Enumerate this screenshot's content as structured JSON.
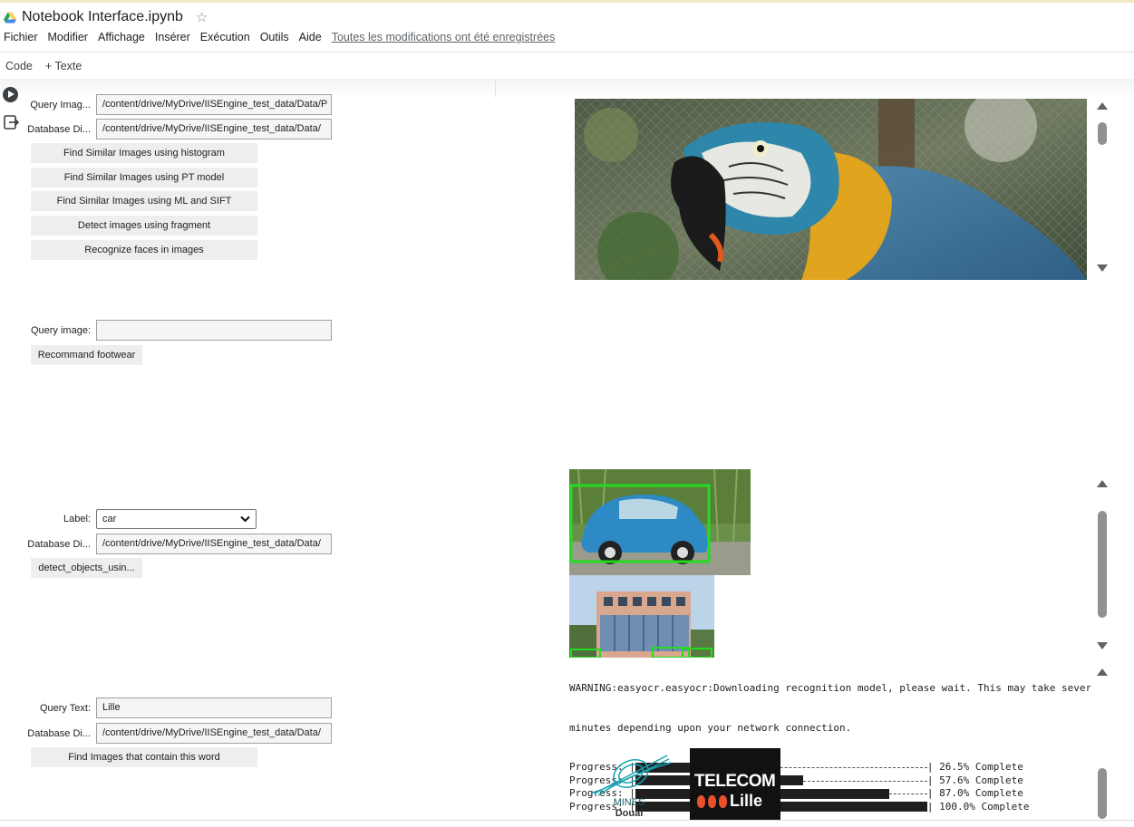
{
  "app": {
    "title": "Notebook Interface.ipynb",
    "menu": [
      "Fichier",
      "Modifier",
      "Affichage",
      "Insérer",
      "Exécution",
      "Outils",
      "Aide"
    ],
    "saved_status": "Toutes les modifications ont été enregistrées",
    "toolbar": {
      "code": "Code",
      "text": "+ Texte"
    }
  },
  "cell1": {
    "query_label": "Query Imag...",
    "query_value": "/content/drive/MyDrive/IISEngine_test_data/Data/P",
    "db_label": "Database Di...",
    "db_value": "/content/drive/MyDrive/IISEngine_test_data/Data/",
    "buttons": [
      "Find Similar Images using histogram",
      "Find Similar Images using PT model",
      "Find Similar Images using ML and SIFT",
      "Detect images using fragment",
      "Recognize faces in images"
    ]
  },
  "cell2": {
    "query_label": "Query image:",
    "query_value": "",
    "button": "Recommand footwear"
  },
  "cell3": {
    "label_label": "Label:",
    "label_value": "car",
    "db_label": "Database Di...",
    "db_value": "/content/drive/MyDrive/IISEngine_test_data/Data/",
    "button": "detect_objects_usin..."
  },
  "cell4": {
    "query_label": "Query Text:",
    "query_value": "Lille",
    "db_label": "Database Di...",
    "db_value": "/content/drive/MyDrive/IISEngine_test_data/Data/",
    "button": "Find Images that contain this word"
  },
  "console": {
    "warning_line1": "WARNING:easyocr.easyocr:Downloading recognition model, please wait. This may take several",
    "warning_line2": "minutes depending upon your network connection.",
    "progress": [
      {
        "prefix": "Progress: |",
        "fraction": 0.265,
        "suffix": "| 26.5% Complete"
      },
      {
        "prefix": "Progress: |",
        "fraction": 0.576,
        "suffix": "| 57.6% Complete"
      },
      {
        "prefix": "Progress: |",
        "fraction": 0.87,
        "suffix": "| 87.0% Complete"
      },
      {
        "prefix": "Progress: |",
        "fraction": 1.0,
        "suffix": "| 100.0% Complete"
      }
    ]
  },
  "logos": {
    "mines_line1": "MINES",
    "mines_line2": "Douai",
    "telecom_line1": "TELECOM",
    "telecom_line2": "Lille"
  },
  "colors": {
    "detection_box": "#22dd22",
    "button_bg": "#eeeeee",
    "drive_logo": [
      "#1fa463",
      "#ffd04b",
      "#4688f4"
    ]
  }
}
